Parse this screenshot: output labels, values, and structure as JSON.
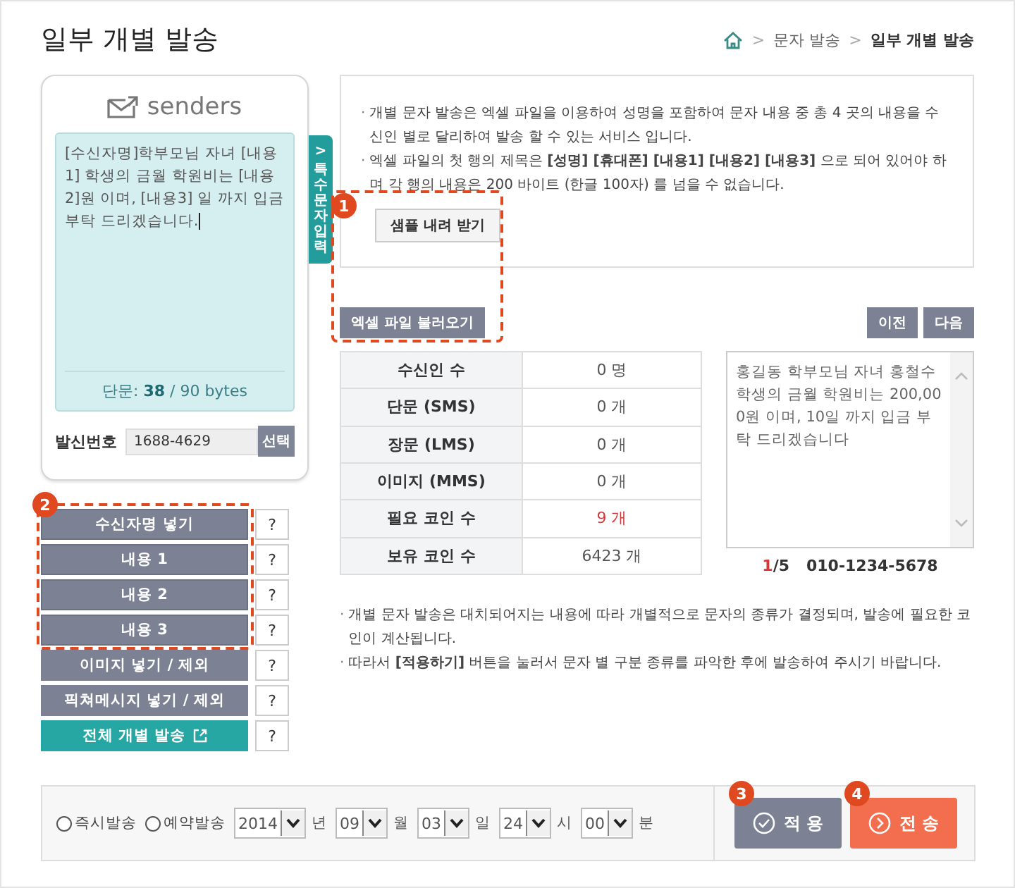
{
  "page": {
    "title": "일부 개별 발송"
  },
  "breadcrumb": [
    {
      "label": "문자 발송",
      "current": false
    },
    {
      "label": "일부 개별 발송",
      "current": true
    }
  ],
  "breadcrumb_separator": ">",
  "bullet": "·",
  "phone": {
    "brand": "senders",
    "message": "[수신자명]학부모님 자녀 [내용1] 학생의 금월 학원비는 [내용2]원 이며, [내용3] 일 까지 입금 부탁 드리겠습니다.",
    "byte_label": "단문:",
    "byte_count": "38",
    "byte_limit": "/ 90 bytes",
    "special_tab_arrow": ">",
    "special_tab": "특수문자 입력",
    "sender_label": "발신번호",
    "sender_value": "1688-4629",
    "select_button": "선택"
  },
  "insert_callout": "2",
  "insert_buttons": [
    {
      "label": "수신자명 넣기",
      "kind": "plain",
      "in_callout": true,
      "help": "?"
    },
    {
      "label": "내용 1",
      "kind": "plain",
      "in_callout": true,
      "help": "?"
    },
    {
      "label": "내용 2",
      "kind": "plain",
      "in_callout": true,
      "help": "?"
    },
    {
      "label": "내용 3",
      "kind": "plain",
      "in_callout": true,
      "help": "?"
    },
    {
      "label": "이미지 넣기 / 제외",
      "kind": "plain",
      "in_callout": false,
      "help": "?"
    },
    {
      "label": "픽쳐메시지 넣기 / 제외",
      "kind": "plain",
      "in_callout": false,
      "help": "?"
    },
    {
      "label": "전체 개별 발송",
      "kind": "external",
      "in_callout": false,
      "help": "?"
    }
  ],
  "info": {
    "lines": [
      "개별 문자 발송은 엑셀 파일을 이용하여 성명을 포함하여 문자 내용 중 총 4 곳의 내용을 수신인 별로 달리하여 발송 할 수 있는 서비스 입니다.",
      "엑셀 파일의 첫 행의 제목은 **[성명] [휴대폰] [내용1] [내용2] [내용3]** 으로 되어 있어야 하며 각 행의 내용은 200 바이트 (한글 100자) 를 넘을 수 없습니다."
    ],
    "sample_button": "샘플 내려 받기"
  },
  "excel_callout": "1",
  "excel_button": "엑셀 파일 불러오기",
  "nav_buttons": [
    "이전",
    "다음"
  ],
  "summary": [
    {
      "label": "수신인 수",
      "value": "0 명",
      "highlight": false
    },
    {
      "label": "단문 (SMS)",
      "value": "0 개",
      "highlight": false
    },
    {
      "label": "장문 (LMS)",
      "value": "0 개",
      "highlight": false
    },
    {
      "label": "이미지 (MMS)",
      "value": "0 개",
      "highlight": false
    },
    {
      "label": "필요 코인 수",
      "value": "9 개",
      "highlight": true
    },
    {
      "label": "보유 코인 수",
      "value": "6423 개",
      "highlight": false
    }
  ],
  "preview": {
    "text": "홍길동 학부모님 자녀 홍철수 학생의 금월 학원비는 200,000원 이며, 10일 까지 입금 부탁 드리겠습니다",
    "index": "1",
    "total": "/5",
    "phone": "010-1234-5678"
  },
  "notes": [
    "개별 문자 발송은 대치되어지는 내용에 따라 개별적으로 문자의 종류가 결정되며, 발송에 필요한 코인이 계산됩니다.",
    "따라서 **[적용하기]** 버튼을 눌러서 문자 별 구분 종류를 파악한 후에 발송하여 주시기 바랍니다."
  ],
  "schedule": {
    "options": [
      {
        "label": "즉시발송",
        "selected": false
      },
      {
        "label": "예약발송",
        "selected": false
      }
    ],
    "fields": [
      {
        "value": "2014",
        "unit": "년"
      },
      {
        "value": "09",
        "unit": "월"
      },
      {
        "value": "03",
        "unit": "일"
      },
      {
        "value": "24",
        "unit": "시"
      },
      {
        "value": "00",
        "unit": "분"
      }
    ]
  },
  "actions": [
    {
      "label": "적 용",
      "kind": "apply",
      "callout": "3"
    },
    {
      "label": "전 송",
      "kind": "send",
      "callout": "4"
    }
  ]
}
